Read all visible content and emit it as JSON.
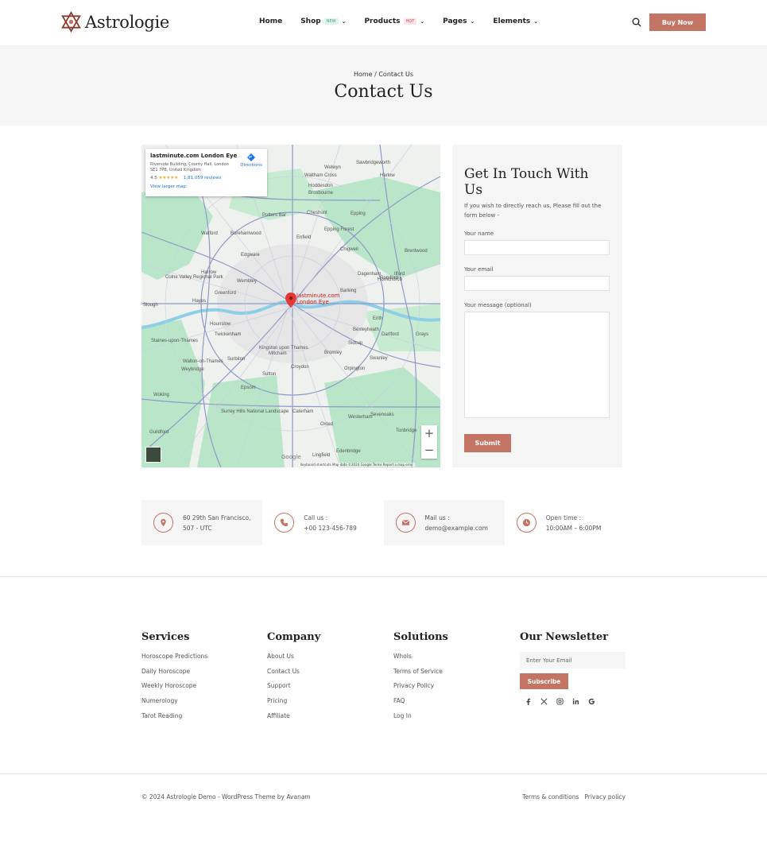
{
  "brand": {
    "name": "Astrologie",
    "accent": "#c47462"
  },
  "nav": {
    "items": [
      {
        "label": "Home"
      },
      {
        "label": "Shop",
        "badge": "NEW"
      },
      {
        "label": "Products",
        "badge": "HOT"
      },
      {
        "label": "Pages"
      },
      {
        "label": "Elements"
      }
    ],
    "buy_label": "Buy Now"
  },
  "title_band": {
    "breadcrumb": "Home / Contact Us",
    "title": "Contact Us"
  },
  "map": {
    "place_name": "lastminute.com London Eye",
    "address": "Riverside Building, County Hall, London SE1 7PB, United Kingdom",
    "rating": "4.5",
    "stars": "★★★★★",
    "reviews": "1,81,059 reviews",
    "directions": "Directions",
    "larger_map": "View larger map",
    "pin_label_1": "lastminute.com",
    "pin_label_2": "London Eye",
    "google": "Google",
    "footer": "Keyboard shortcuts   Map data ©2024 Google   Terms   Report a map error",
    "zoom_in": "+",
    "zoom_out": "−",
    "labels": [
      "Watford",
      "Borehamwood",
      "Enfield",
      "Epping",
      "Edgware",
      "Chigwell",
      "Harrow",
      "Wembley",
      "Ilford",
      "Romford",
      "Dagenham",
      "Hornchurch",
      "Slough",
      "Hayes",
      "Greenford",
      "Hounslow",
      "Barking",
      "Twickenham",
      "Kingston upon Thames",
      "Mitcham",
      "Croydon",
      "Bromley",
      "Sidcup",
      "Dartford",
      "Orpington",
      "Swanley",
      "Sutton",
      "Epsom",
      "Weybridge",
      "Woking",
      "Caterham",
      "Westerham",
      "Sevenoaks",
      "Oxted",
      "Guildford",
      "Tonbridge",
      "Edenbridge",
      "Lingfield",
      "Brentwood",
      "Cheshunt",
      "Hoddesdon",
      "Sawbridgeworth",
      "Potters Bar",
      "Broxbourne",
      "Waltham Cross",
      "Epping Forest",
      "Colne Valley Regional Park",
      "Staines-upon-Thames",
      "Walton-on-Thames",
      "Erith",
      "Bexleyheath",
      "Grays",
      "Surrey Hills National Landscape",
      "Surbiton",
      "Harlow",
      "Welwyn"
    ]
  },
  "form": {
    "title": "Get In Touch With Us",
    "subtitle": "If you wish to directly reach us, Please fill out the form below -",
    "name_label": "Your name",
    "email_label": "Your email",
    "message_label": "Your message (optional)",
    "submit_label": "Submit"
  },
  "info": [
    {
      "icon": "location-pin-icon",
      "line1": "60 29th San Francisco,",
      "line2": "507 - UTC"
    },
    {
      "icon": "phone-icon",
      "line1": "Call us :",
      "line2": "+00 123-456-789"
    },
    {
      "icon": "mail-icon",
      "line1": "Mail us :",
      "line2": "demo@example.com"
    },
    {
      "icon": "clock-icon",
      "line1": "Open time :",
      "line2": "10:00AM – 6:00PM"
    }
  ],
  "footer": {
    "services": {
      "title": "Services",
      "items": [
        "Horoscope Predictions",
        "Daily Horoscope",
        "Weekly Horoscope",
        "Numerology",
        "Tarot Reading"
      ]
    },
    "company": {
      "title": "Company",
      "items": [
        "About Us",
        "Contact Us",
        "Support",
        "Pricing",
        "Affiliate"
      ]
    },
    "solutions": {
      "title": "Solutions",
      "items": [
        "WhoIs",
        "Terms of Service",
        "Privacy Policy",
        "FAQ",
        "Log In"
      ]
    },
    "newsletter": {
      "title": "Our Newsletter",
      "placeholder": "Enter Your Email",
      "subscribe_label": "Subscribe",
      "socials": [
        "facebook-icon",
        "x-icon",
        "instagram-icon",
        "linkedin-icon",
        "google-icon"
      ]
    },
    "copyright": "© 2024 Astrologie Demo - WordPress Theme by Avanam",
    "terms": "Terms & conditions",
    "privacy": "Privacy policy"
  }
}
